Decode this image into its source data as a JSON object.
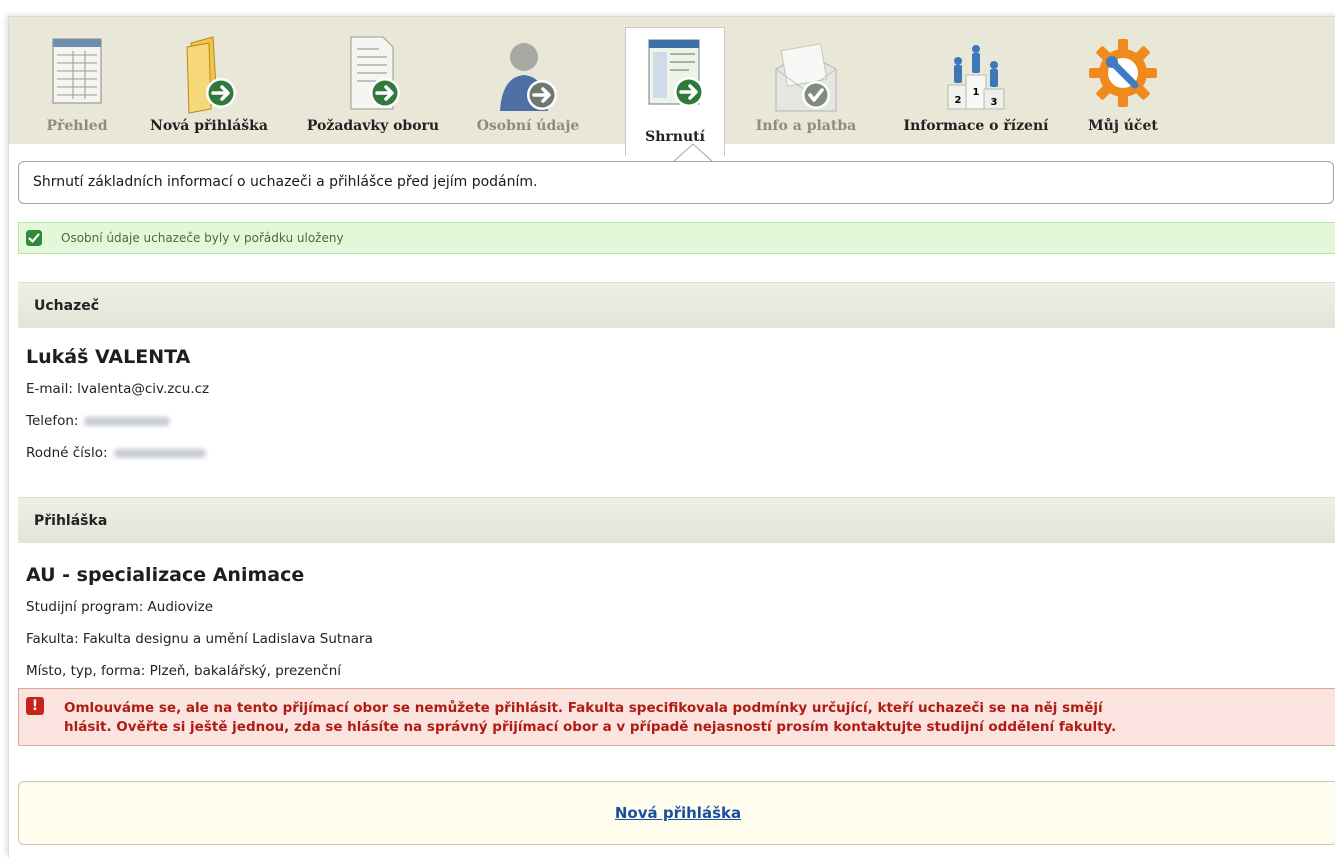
{
  "tabs": [
    {
      "key": "prehled",
      "label": "Přehled",
      "muted": true,
      "icon": "table-document-icon"
    },
    {
      "key": "nova",
      "label": "Nová přihláška",
      "muted": false,
      "icon": "folder-arrow-icon"
    },
    {
      "key": "pozadavky",
      "label": "Požadavky oboru",
      "muted": false,
      "icon": "document-arrow-icon"
    },
    {
      "key": "osobni",
      "label": "Osobní údaje",
      "muted": true,
      "icon": "person-arrow-icon"
    },
    {
      "key": "shrnuti",
      "label": "Shrnutí",
      "muted": false,
      "active": true,
      "icon": "screen-arrow-icon"
    },
    {
      "key": "info",
      "label": "Info a platba",
      "muted": true,
      "icon": "envelope-check-icon"
    },
    {
      "key": "rizeni",
      "label": "Informace o řízení",
      "muted": false,
      "icon": "podium-icon"
    },
    {
      "key": "ucet",
      "label": "Můj účet",
      "muted": false,
      "icon": "gear-wrench-icon"
    }
  ],
  "description": "Shrnutí základních informací o uchazeči a přihlášce před jejím podáním.",
  "success_message": "Osobní údaje uchazeče byly v pořádku uloženy",
  "applicant": {
    "section_title": "Uchazeč",
    "name": "Lukáš VALENTA",
    "email_label": "E-mail:",
    "email": "lvalenta@civ.zcu.cz",
    "phone_label": "Telefon:",
    "birth_number_label": "Rodné číslo:"
  },
  "application": {
    "section_title": "Přihláška",
    "field_name": "AU - specializace Animace",
    "program": "Studijní program: Audiovize",
    "faculty": "Fakulta: Fakulta designu a umění Ladislava Sutnara",
    "place": "Místo, typ, forma: Plzeň, bakalářský, prezenční"
  },
  "error_message_line1": "Omlouváme se, ale na tento přijímací obor se nemůžete přihlásit. Fakulta specifikovala podmínky určující, kteří uchazeči se na něj smějí",
  "error_message_line2": "hlásit. Ověřte si ještě jednou, zda se hlásíte na správný přijímací obor a v případě nejasností prosím kontaktujte studijní oddělení fakulty.",
  "error_icon": "!",
  "new_application_link": "Nová přihláška",
  "colors": {
    "tabbar_bg": "#e8e7d8",
    "success_bg": "#e5f7d9",
    "error_bg": "#fbe3e0",
    "error_text": "#b01c12",
    "link": "#1a4ea0"
  }
}
